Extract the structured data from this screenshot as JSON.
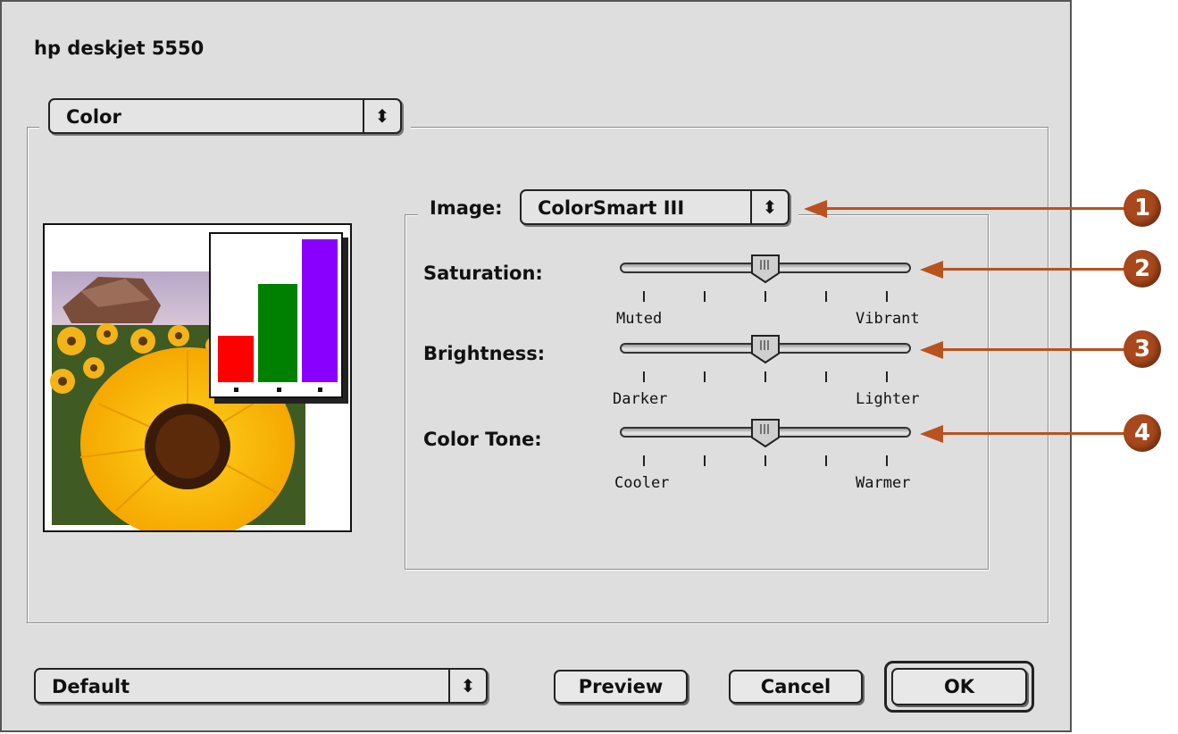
{
  "dialog": {
    "title": "hp deskjet 5550"
  },
  "panel_menu": {
    "selected": "Color",
    "arrow": "⬍"
  },
  "image": {
    "label": "Image:",
    "selected": "ColorSmart III",
    "arrow": "⬍"
  },
  "sliders": [
    {
      "label": "Saturation:",
      "min_label": "Muted",
      "max_label": "Vibrant",
      "level": 0.5
    },
    {
      "label": "Brightness:",
      "min_label": "Darker",
      "max_label": "Lighter",
      "level": 0.5
    },
    {
      "label": "Color Tone:",
      "min_label": "Cooler",
      "max_label": "Warmer",
      "level": 0.5
    }
  ],
  "preview_chart": {
    "bar_colors": [
      "#ff0000",
      "#008000",
      "#8a00ff"
    ],
    "bar_levels": [
      0.45,
      0.72,
      1.0
    ]
  },
  "footer": {
    "preset": "Default",
    "preset_arrow": "⬍",
    "preview_label": "Preview",
    "cancel_label": "Cancel",
    "ok_label": "OK"
  },
  "callouts": [
    "1",
    "2",
    "3",
    "4"
  ],
  "colors": {
    "callout": "#a8481c",
    "dialog_bg": "#dedede"
  }
}
